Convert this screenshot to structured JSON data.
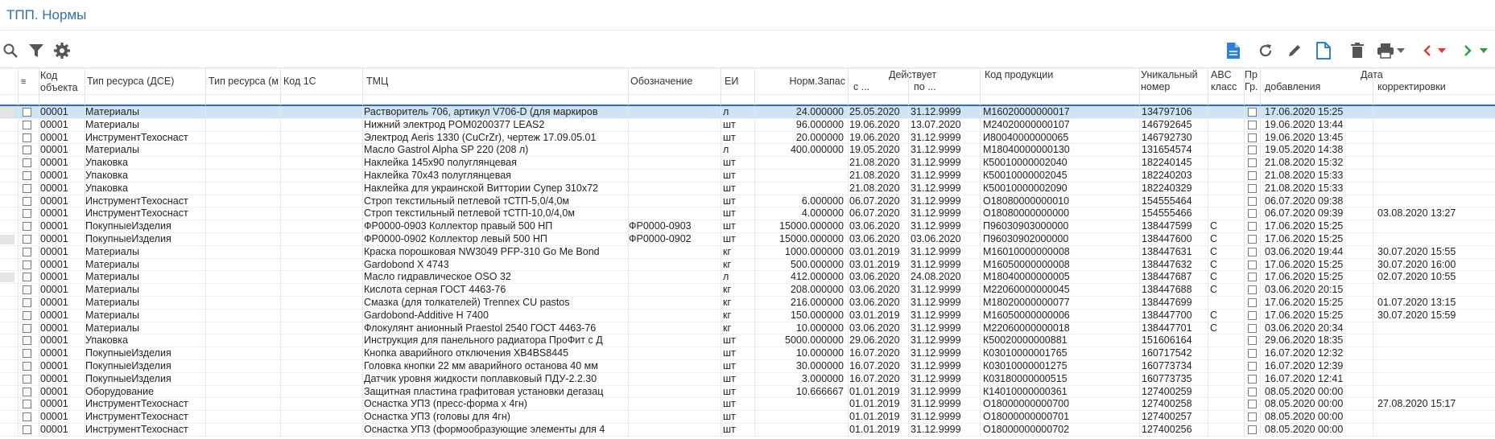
{
  "title": "ТПП. Нормы",
  "toolbar": {
    "left": [
      "search-icon",
      "filter-icon",
      "gear-icon"
    ],
    "right": [
      "document-icon",
      "refresh-icon",
      "pencil-icon",
      "document-outline-icon",
      "trash-icon",
      "printer-icon",
      "chevron-down-icon",
      "arrow-left-icon",
      "arrow-down-icon",
      "arrow-right-icon",
      "arrow-down-icon"
    ]
  },
  "header": {
    "sort": "≡",
    "kod_obj": "Код объекта",
    "tip_res": "Тип ресурса (ДСЕ)",
    "tip_res2": "Тип ресурса (м",
    "kod1c": "Код 1С",
    "tmc": "ТМЦ",
    "oboz": "Обозначение",
    "ei": "ЕИ",
    "norm": "Норм.Запас",
    "deystvuet": "Действует",
    "s": "с ...",
    "po": "по ...",
    "kod_prod": "Код продукции",
    "uniq": "Уникальный номер",
    "abc": "ABC класс",
    "gr": "Пр Гр.",
    "data": "Дата",
    "dob": "добавления",
    "korr": "корректировки"
  },
  "rows": [
    {
      "obj": "00001",
      "tip": "Материалы",
      "tmc": "Растворитель 706, артикул V706-D (для маркиров",
      "oboz": "",
      "ei": "л",
      "norm": "24.000000",
      "s": "25.05.2020",
      "po": "31.12.9999",
      "kod": "М16020000000017",
      "uniq": "134797106",
      "abc": "",
      "dob": "17.06.2020 15:25",
      "korr": "",
      "sel": true,
      "mark": true
    },
    {
      "obj": "00001",
      "tip": "Материалы",
      "tmc": "Нижний электрод POM0200377 LEAS2",
      "oboz": "",
      "ei": "шт",
      "norm": "96.000000",
      "s": "19.06.2020",
      "po": "13.07.2020",
      "kod": "М24020000000107",
      "uniq": "146792645",
      "abc": "",
      "dob": "19.06.2020 13:44",
      "korr": ""
    },
    {
      "obj": "00001",
      "tip": "ИнструментТехоснаст",
      "tmc": "Электрод Aeris 1330 (CuCrZr), чертеж 17.09.05.01",
      "oboz": "",
      "ei": "шт",
      "norm": "20.000000",
      "s": "19.06.2020",
      "po": "31.12.9999",
      "kod": "И80040000000065",
      "uniq": "146792730",
      "abc": "",
      "dob": "19.06.2020 13:45",
      "korr": ""
    },
    {
      "obj": "00001",
      "tip": "Материалы",
      "tmc": "Масло Gastrol Alpha SP 220 (208 л)",
      "oboz": "",
      "ei": "л",
      "norm": "400.000000",
      "s": "19.05.2020",
      "po": "31.12.9999",
      "kod": "М18040000000130",
      "uniq": "131654574",
      "abc": "",
      "dob": "19.05.2020 14:38",
      "korr": ""
    },
    {
      "obj": "00001",
      "tip": "Упаковка",
      "tmc": "Наклейка 145х90 полуглянцевая",
      "oboz": "",
      "ei": "шт",
      "norm": "",
      "s": "21.08.2020",
      "po": "31.12.9999",
      "kod": "К50010000002040",
      "uniq": "182240145",
      "abc": "",
      "dob": "21.08.2020 15:32",
      "korr": ""
    },
    {
      "obj": "00001",
      "tip": "Упаковка",
      "tmc": "Наклейка 70х43 полуглянцевая",
      "oboz": "",
      "ei": "шт",
      "norm": "",
      "s": "21.08.2020",
      "po": "31.12.9999",
      "kod": "К50010000002045",
      "uniq": "182240203",
      "abc": "",
      "dob": "21.08.2020 15:33",
      "korr": ""
    },
    {
      "obj": "00001",
      "tip": "Упаковка",
      "tmc": "Наклейка для украинской Виттории Супер 310х72",
      "oboz": "",
      "ei": "шт",
      "norm": "",
      "s": "21.08.2020",
      "po": "31.12.9999",
      "kod": "К50010000002090",
      "uniq": "182240329",
      "abc": "",
      "dob": "21.08.2020 15:33",
      "korr": ""
    },
    {
      "obj": "00001",
      "tip": "ИнструментТехоснаст",
      "tmc": "Строп текстильный петлевой тСТП-5,0/4,0м",
      "oboz": "",
      "ei": "шт",
      "norm": "6.000000",
      "s": "06.07.2020",
      "po": "31.12.9999",
      "kod": "О18080000000010",
      "uniq": "154555464",
      "abc": "",
      "dob": "06.07.2020 09:38",
      "korr": ""
    },
    {
      "obj": "00001",
      "tip": "ИнструментТехоснаст",
      "tmc": "Строп текстильный петлевой тСТП-10,0/4,0м",
      "oboz": "",
      "ei": "шт",
      "norm": "4.000000",
      "s": "06.07.2020",
      "po": "31.12.9999",
      "kod": "О18080000000000",
      "uniq": "154555466",
      "abc": "",
      "dob": "06.07.2020 09:39",
      "korr": "03.08.2020 13:27"
    },
    {
      "obj": "00001",
      "tip": "ПокупныеИзделия",
      "tmc": "ФР0000-0903 Коллектор правый 500 НП",
      "oboz": "ФР0000-0903",
      "ei": "шт",
      "norm": "15000.000000",
      "s": "03.06.2020",
      "po": "31.12.9999",
      "kod": "П96030903000000",
      "uniq": "138447599",
      "abc": "С",
      "dob": "17.06.2020 15:25",
      "korr": ""
    },
    {
      "obj": "00001",
      "tip": "ПокупныеИзделия",
      "tmc": "ФР0000-0902 Коллектор левый 500 НП",
      "oboz": "ФР0000-0902",
      "ei": "шт",
      "norm": "15000.000000",
      "s": "03.06.2020",
      "po": "03.06.2020",
      "kod": "П96030902000000",
      "uniq": "138447600",
      "abc": "С",
      "dob": "17.06.2020 15:25",
      "korr": "",
      "mark": true
    },
    {
      "obj": "00001",
      "tip": "Материалы",
      "tmc": "Краска порошковая NW3049 PFP-310 Go Me Bond",
      "oboz": "",
      "ei": "кг",
      "norm": "1000.000000",
      "s": "03.01.2019",
      "po": "31.12.9999",
      "kod": "М16010000000008",
      "uniq": "138447631",
      "abc": "С",
      "dob": "03.06.2020 19:44",
      "korr": "30.07.2020 15:55"
    },
    {
      "obj": "00001",
      "tip": "Материалы",
      "tmc": "Gardobond X 4743",
      "oboz": "",
      "ei": "кг",
      "norm": "500.000000",
      "s": "03.01.2019",
      "po": "31.12.9999",
      "kod": "М16050000000008",
      "uniq": "138447632",
      "abc": "С",
      "dob": "17.06.2020 15:25",
      "korr": "30.07.2020 16:00"
    },
    {
      "obj": "00001",
      "tip": "Материалы",
      "tmc": "Масло гидравлическое OSO 32",
      "oboz": "",
      "ei": "л",
      "norm": "412.000000",
      "s": "03.06.2020",
      "po": "24.08.2020",
      "kod": "М18040000000005",
      "uniq": "138447687",
      "abc": "С",
      "dob": "17.06.2020 15:25",
      "korr": "02.07.2020 10:55",
      "mark": true
    },
    {
      "obj": "00001",
      "tip": "Материалы",
      "tmc": "Кислота серная ГОСТ 4463-76",
      "oboz": "",
      "ei": "кг",
      "norm": "208.000000",
      "s": "03.06.2020",
      "po": "31.12.9999",
      "kod": "М22060000000045",
      "uniq": "138447688",
      "abc": "С",
      "dob": "03.06.2020 20:15",
      "korr": ""
    },
    {
      "obj": "00001",
      "tip": "Материалы",
      "tmc": "Смазка (для толкателей) Trennex CU pastos",
      "oboz": "",
      "ei": "кг",
      "norm": "216.000000",
      "s": "03.06.2020",
      "po": "31.12.9999",
      "kod": "М18020000000077",
      "uniq": "138447699",
      "abc": "",
      "dob": "17.06.2020 15:25",
      "korr": "01.07.2020 13:15"
    },
    {
      "obj": "00001",
      "tip": "Материалы",
      "tmc": "Gardobond-Additive H 7400",
      "oboz": "",
      "ei": "кг",
      "norm": "150.000000",
      "s": "03.01.2019",
      "po": "31.12.9999",
      "kod": "М16050000000006",
      "uniq": "138447700",
      "abc": "С",
      "dob": "17.06.2020 15:25",
      "korr": "30.07.2020 15:59"
    },
    {
      "obj": "00001",
      "tip": "Материалы",
      "tmc": "Флокулянт анионный Praestol 2540 ГОСТ 4463-76",
      "oboz": "",
      "ei": "кг",
      "norm": "10.000000",
      "s": "03.06.2020",
      "po": "31.12.9999",
      "kod": "М22060000000018",
      "uniq": "138447701",
      "abc": "С",
      "dob": "03.06.2020 20:34",
      "korr": ""
    },
    {
      "obj": "00001",
      "tip": "Упаковка",
      "tmc": "Инструкция для панельного радиатора ПроФит с Д",
      "oboz": "",
      "ei": "шт",
      "norm": "5000.000000",
      "s": "29.06.2020",
      "po": "31.12.9999",
      "kod": "К50020000000881",
      "uniq": "151606164",
      "abc": "",
      "dob": "29.06.2020 18:35",
      "korr": ""
    },
    {
      "obj": "00001",
      "tip": "ПокупныеИзделия",
      "tmc": "Кнопка аварийного отключения XB4BS8445",
      "oboz": "",
      "ei": "шт",
      "norm": "10.000000",
      "s": "16.07.2020",
      "po": "31.12.9999",
      "kod": "К03010000001765",
      "uniq": "160717542",
      "abc": "",
      "dob": "16.07.2020 12:32",
      "korr": ""
    },
    {
      "obj": "00001",
      "tip": "ПокупныеИзделия",
      "tmc": "Головка кнопки 22 мм аварийного останова 40 мм",
      "oboz": "",
      "ei": "шт",
      "norm": "30.000000",
      "s": "16.07.2020",
      "po": "31.12.9999",
      "kod": "К03010000001275",
      "uniq": "160773734",
      "abc": "",
      "dob": "16.07.2020 12:39",
      "korr": ""
    },
    {
      "obj": "00001",
      "tip": "ПокупныеИзделия",
      "tmc": "Датчик уровня жидкости поплавковый ПДУ-2.2.30",
      "oboz": "",
      "ei": "шт",
      "norm": "3.000000",
      "s": "16.07.2020",
      "po": "31.12.9999",
      "kod": "К03180000000515",
      "uniq": "160773735",
      "abc": "",
      "dob": "16.07.2020 12:41",
      "korr": ""
    },
    {
      "obj": "00001",
      "tip": "Оборудование",
      "tmc": "Защитная пластина графитовая установки дегазац",
      "oboz": "",
      "ei": "шт",
      "norm": "10.666667",
      "s": "01.01.2019",
      "po": "31.12.9999",
      "kod": "К14010000000361",
      "uniq": "127400259",
      "abc": "",
      "dob": "08.05.2020 00:00",
      "korr": ""
    },
    {
      "obj": "00001",
      "tip": "ИнструментТехоснаст",
      "tmc": "Оснастка УПЗ (пресс-форма х 4гн)",
      "oboz": "",
      "ei": "шт",
      "norm": "",
      "s": "01.01.2019",
      "po": "31.12.9999",
      "kod": "О18000000000700",
      "uniq": "127400258",
      "abc": "",
      "dob": "08.05.2020 00:00",
      "korr": "27.08.2020 15:17"
    },
    {
      "obj": "00001",
      "tip": "ИнструментТехоснаст",
      "tmc": "Оснастка УПЗ (головы для 4гн)",
      "oboz": "",
      "ei": "шт",
      "norm": "",
      "s": "01.01.2019",
      "po": "31.12.9999",
      "kod": "О18000000000701",
      "uniq": "127400257",
      "abc": "",
      "dob": "08.05.2020 00:00",
      "korr": ""
    },
    {
      "obj": "00001",
      "tip": "ИнструментТехоснаст",
      "tmc": "Оснастка УПЗ (формообразующие элементы для 4",
      "oboz": "",
      "ei": "шт",
      "norm": "",
      "s": "01.01.2019",
      "po": "31.12.9999",
      "kod": "О18000000000702",
      "uniq": "127400256",
      "abc": "",
      "dob": "08.05.2020 00:00",
      "korr": ""
    }
  ]
}
